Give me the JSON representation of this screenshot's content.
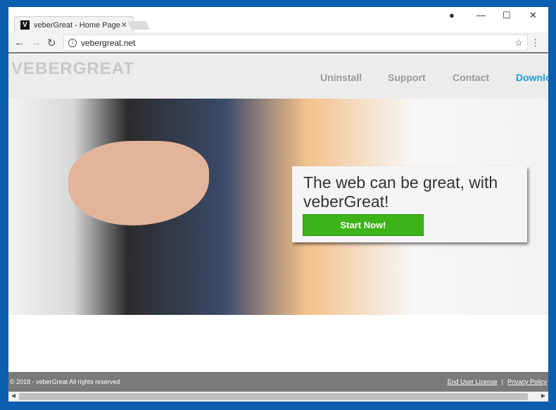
{
  "browser": {
    "tab_title": "veberGreat - Home Page",
    "favicon_letter": "V",
    "url": "vebergreat.net"
  },
  "site": {
    "logo": "VEBERGREAT",
    "nav": [
      "Uninstall",
      "Support",
      "Contact",
      "Downlo"
    ],
    "nav_active_color": "#1a9ee0",
    "headline": "The web can be great, with veberGreat!",
    "cta": "Start Now!",
    "cta_color": "#3cb319",
    "footer": {
      "copyright": "© 2018 - veberGreat All rights reserved",
      "links": [
        "End User License",
        "Privacy Policy"
      ],
      "separator": "|"
    }
  }
}
